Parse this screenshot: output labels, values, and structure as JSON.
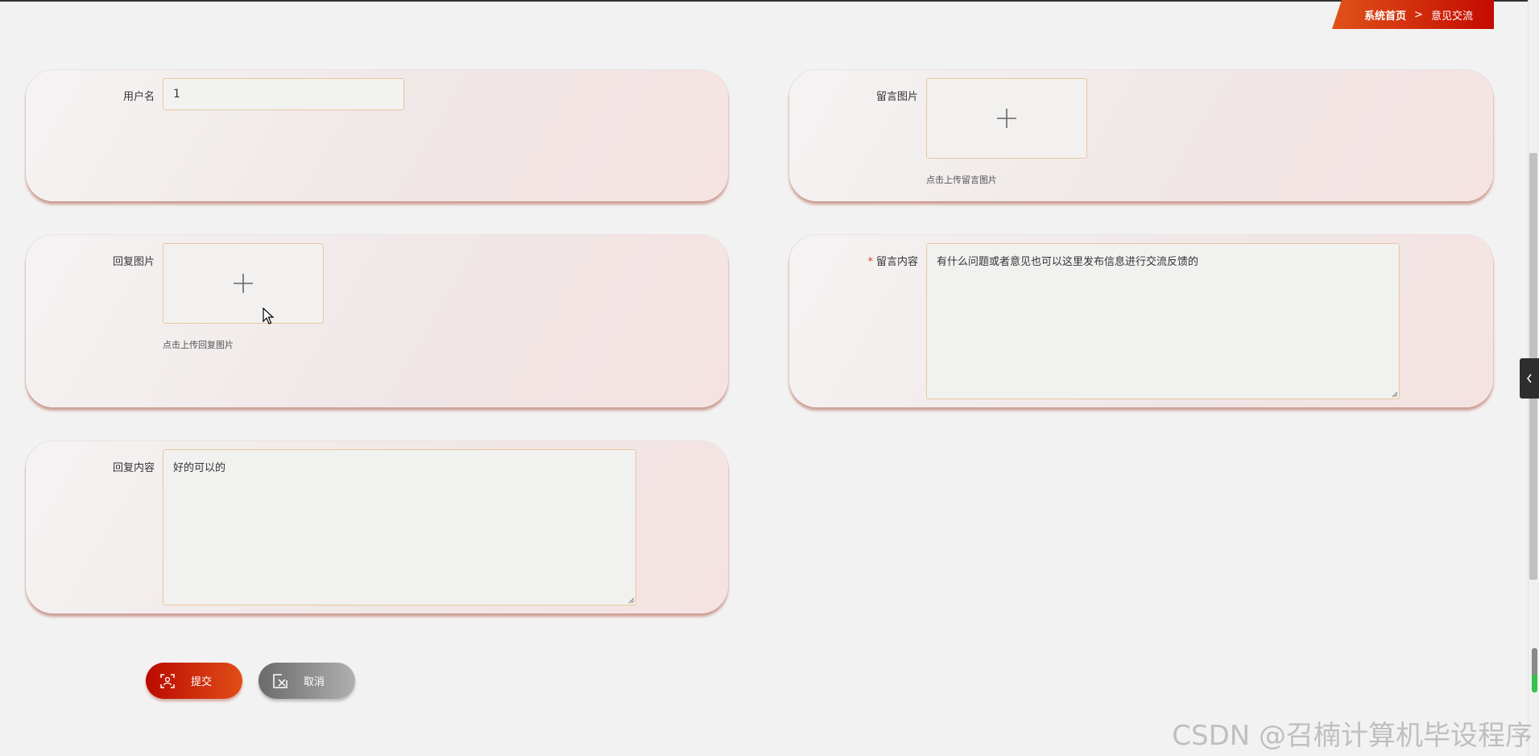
{
  "breadcrumb": {
    "home": "系统首页",
    "separator": ">",
    "current": "意见交流"
  },
  "form": {
    "username": {
      "label": "用户名",
      "value": "1"
    },
    "message_image": {
      "label": "留言图片",
      "hint": "点击上传留言图片",
      "icon": "plus-icon"
    },
    "reply_image": {
      "label": "回复图片",
      "hint": "点击上传回复图片",
      "icon": "plus-icon"
    },
    "message_content": {
      "required_mark": "*",
      "label": "留言内容",
      "value": "有什么问题或者意见也可以这里发布信息进行交流反馈的"
    },
    "reply_content": {
      "label": "回复内容",
      "value": "好的可以的"
    }
  },
  "actions": {
    "submit_label": "提交",
    "submit_icon": "scan-face-icon",
    "cancel_label": "取消",
    "cancel_icon": "close-box-icon"
  },
  "watermark": "CSDN @召楠计算机毕设程序",
  "colors": {
    "accent": "#c40a00",
    "accent_light": "#e0531a",
    "input_border": "#e8c79c",
    "required": "#e03c2c"
  }
}
